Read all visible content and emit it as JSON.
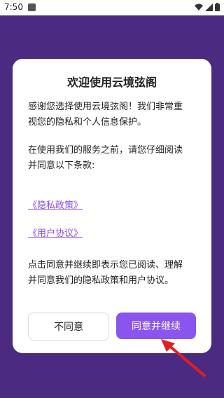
{
  "status_bar": {
    "time": "7:50"
  },
  "dialog": {
    "title": "欢迎使用云境弦阁",
    "intro_line1": "感谢您选择使用云境弦阁！我们非常重",
    "intro_line2": "视您的隐私和个人信息保护。",
    "before_line1": "在使用我们的服务之前，请您仔细阅读",
    "before_line2": "并同意以下条款:",
    "privacy_link": "《隐私政策》",
    "user_agreement_link": "《用户协议》",
    "notice_line1": "点击同意并继续即表示您已阅读、理解",
    "notice_line2": "并同意我们的隐私政策和用户协议。",
    "decline_label": "不同意",
    "accept_label": "同意并继续"
  },
  "colors": {
    "background": "#4b2a82",
    "accent": "#8a55ef",
    "link": "#8a4fe6",
    "arrow": "#e02020"
  }
}
